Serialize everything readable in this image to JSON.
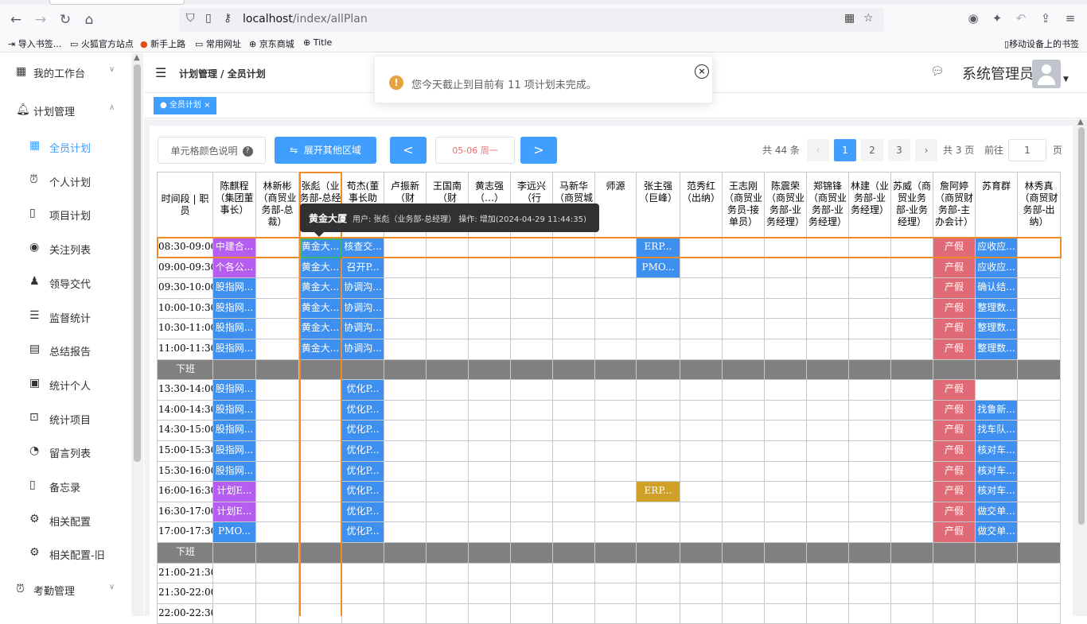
{
  "browser": {
    "url_host": "localhost",
    "url_path": "/index/allPlan",
    "bookmarks": [
      "导入书签...",
      "火狐官方站点",
      "新手上路",
      "常用网址",
      "京东商城",
      "Title"
    ],
    "mobile_bookmarks": "移动设备上的书签"
  },
  "sidebar": {
    "top_items": [
      {
        "label": "我的工作台",
        "icon": "calendar-icon"
      },
      {
        "label": "计划管理",
        "icon": "bell-icon"
      },
      {
        "label": "考勤管理",
        "icon": "alarm-icon"
      }
    ],
    "sub_items": [
      {
        "label": "全员计划",
        "icon": "calendar-icon",
        "active": true
      },
      {
        "label": "个人计划",
        "icon": "alarm-icon"
      },
      {
        "label": "项目计划",
        "icon": "phone-icon"
      },
      {
        "label": "关注列表",
        "icon": "eye-icon"
      },
      {
        "label": "领导交代",
        "icon": "user-icon"
      },
      {
        "label": "监督统计",
        "icon": "list-icon"
      },
      {
        "label": "总结报告",
        "icon": "document-icon"
      },
      {
        "label": "统计个人",
        "icon": "briefcase-icon"
      },
      {
        "label": "统计项目",
        "icon": "presentation-icon"
      },
      {
        "label": "留言列表",
        "icon": "chat-icon"
      },
      {
        "label": "备忘录",
        "icon": "phone-icon"
      },
      {
        "label": "相关配置",
        "icon": "gear-icon"
      },
      {
        "label": "相关配置-旧",
        "icon": "gear-icon"
      }
    ]
  },
  "header": {
    "breadcrumb": "计划管理 / 全员计划",
    "username": "系统管理员",
    "tag": "全员计划"
  },
  "notification": {
    "message": "您今天截止到目前有 11 项计划未完成。"
  },
  "toolbar": {
    "legend_label": "单元格颜色说明",
    "expand_label": "展开其他区域",
    "prev_label": "<",
    "next_label": ">",
    "date_value": "05-06 周一"
  },
  "pagination": {
    "total": "共 44 条",
    "pages": [
      "1",
      "2",
      "3"
    ],
    "current": "1",
    "page_count": "共 3 页",
    "goto_label": "前往",
    "goto_value": "1",
    "page_suffix": "页"
  },
  "tooltip": {
    "title": "黄金大厦",
    "info": "用户: 张彪（业务部-总经理） 操作: 增加(2024-04-29 11:44:35)"
  },
  "table": {
    "columns": [
      "时间段 | 职员",
      "陈麒程（集团董事长）",
      "林新彬（商贸业务部-总裁）",
      "张彪（业务部-总经理）",
      "苟杰(董事长助理)",
      "卢振新（财务…）",
      "王国南（财务…）",
      "黄志强（…）",
      "李远兴（行政…）",
      "马新华（商贸城市物业-部长）",
      "师源",
      "张主强（巨峰）",
      "范秀红（出纳）",
      "王志刚（商贸业务员-接单员）",
      "陈震荣（商贸业务部-业务经理）",
      "郑锦锋（商贸业务部-业务经理）",
      "林建（业务部-业务经理）",
      "苏威（商贸业务部-业务经理）",
      "詹阿婷（商贸财务部-主办会计）",
      "苏育群",
      "林秀真（商贸财务部-出纳）"
    ],
    "rows": [
      {
        "time": "08:30-09:00",
        "cells": [
          "中建合...",
          "",
          "黄金大...",
          "核查交...",
          "",
          "",
          "",
          "",
          "",
          "",
          "ERP...",
          "",
          "",
          "",
          "",
          "",
          "",
          "产假",
          "应收应...",
          ""
        ]
      },
      {
        "time": "09:00-09:30",
        "cells": [
          "个各公...",
          "",
          "黄金大...",
          "召开P...",
          "",
          "",
          "",
          "",
          "",
          "",
          "PMO...",
          "",
          "",
          "",
          "",
          "",
          "",
          "产假",
          "应收应...",
          ""
        ]
      },
      {
        "time": "09:30-10:00",
        "cells": [
          "股指网...",
          "",
          "黄金大...",
          "协调沟...",
          "",
          "",
          "",
          "",
          "",
          "",
          "",
          "",
          "",
          "",
          "",
          "",
          "",
          "产假",
          "确认结...",
          ""
        ]
      },
      {
        "time": "10:00-10:30",
        "cells": [
          "股指网...",
          "",
          "黄金大...",
          "协调沟...",
          "",
          "",
          "",
          "",
          "",
          "",
          "",
          "",
          "",
          "",
          "",
          "",
          "",
          "产假",
          "整理数...",
          ""
        ]
      },
      {
        "time": "10:30-11:00",
        "cells": [
          "股指网...",
          "",
          "黄金大...",
          "协调沟...",
          "",
          "",
          "",
          "",
          "",
          "",
          "",
          "",
          "",
          "",
          "",
          "",
          "",
          "产假",
          "整理数...",
          ""
        ]
      },
      {
        "time": "11:00-11:30",
        "cells": [
          "股指网...",
          "",
          "黄金大...",
          "协调沟...",
          "",
          "",
          "",
          "",
          "",
          "",
          "",
          "",
          "",
          "",
          "",
          "",
          "",
          "产假",
          "整理数...",
          ""
        ]
      },
      {
        "time": "下班",
        "break": true
      },
      {
        "time": "13:30-14:00",
        "cells": [
          "股指网...",
          "",
          "",
          "优化P...",
          "",
          "",
          "",
          "",
          "",
          "",
          "",
          "",
          "",
          "",
          "",
          "",
          "",
          "产假",
          "",
          ""
        ]
      },
      {
        "time": "14:00-14:30",
        "cells": [
          "股指网...",
          "",
          "",
          "优化P...",
          "",
          "",
          "",
          "",
          "",
          "",
          "",
          "",
          "",
          "",
          "",
          "",
          "",
          "产假",
          "找鲁新...",
          ""
        ]
      },
      {
        "time": "14:30-15:00",
        "cells": [
          "股指网...",
          "",
          "",
          "优化P...",
          "",
          "",
          "",
          "",
          "",
          "",
          "",
          "",
          "",
          "",
          "",
          "",
          "",
          "产假",
          "找车队...",
          ""
        ]
      },
      {
        "time": "15:00-15:30",
        "cells": [
          "股指网...",
          "",
          "",
          "优化P...",
          "",
          "",
          "",
          "",
          "",
          "",
          "",
          "",
          "",
          "",
          "",
          "",
          "",
          "产假",
          "核对车...",
          ""
        ]
      },
      {
        "time": "15:30-16:00",
        "cells": [
          "股指网...",
          "",
          "",
          "优化P...",
          "",
          "",
          "",
          "",
          "",
          "",
          "",
          "",
          "",
          "",
          "",
          "",
          "",
          "产假",
          "核对车...",
          ""
        ]
      },
      {
        "time": "16:00-16:30",
        "cells": [
          "计划E...",
          "",
          "",
          "优化P...",
          "",
          "",
          "",
          "",
          "",
          "",
          "ERP...",
          "",
          "",
          "",
          "",
          "",
          "",
          "产假",
          "核对车...",
          ""
        ]
      },
      {
        "time": "16:30-17:00",
        "cells": [
          "计划E...",
          "",
          "",
          "优化P...",
          "",
          "",
          "",
          "",
          "",
          "",
          "",
          "",
          "",
          "",
          "",
          "",
          "",
          "产假",
          "做交单...",
          ""
        ]
      },
      {
        "time": "17:00-17:30",
        "cells": [
          "PMO...",
          "",
          "",
          "优化P...",
          "",
          "",
          "",
          "",
          "",
          "",
          "",
          "",
          "",
          "",
          "",
          "",
          "",
          "产假",
          "做交单...",
          ""
        ]
      },
      {
        "time": "下班",
        "break": true
      },
      {
        "time": "21:00-21:30",
        "cells": [
          "",
          "",
          "",
          "",
          "",
          "",
          "",
          "",
          "",
          "",
          "",
          "",
          "",
          "",
          "",
          "",
          "",
          "",
          "",
          ""
        ]
      },
      {
        "time": "21:30-22:00",
        "cells": [
          "",
          "",
          "",
          "",
          "",
          "",
          "",
          "",
          "",
          "",
          "",
          "",
          "",
          "",
          "",
          "",
          "",
          "",
          "",
          ""
        ]
      },
      {
        "time": "22:00-22:30",
        "cells": [
          "",
          "",
          "",
          "",
          "",
          "",
          "",
          "",
          "",
          "",
          "",
          "",
          "",
          "",
          "",
          "",
          "",
          "",
          "",
          ""
        ]
      }
    ],
    "colors": {
      "purple": "#b55df0",
      "blue": "#3d8ff0",
      "red": "#e06a75",
      "gold": "#d1a028",
      "break": "#808080"
    },
    "cell_colors": [
      [
        "purple",
        "",
        "blue",
        "blue",
        "",
        "",
        "",
        "",
        "",
        "",
        "blue",
        "",
        "",
        "",
        "",
        "",
        "",
        "red",
        "blue",
        ""
      ],
      [
        "purple",
        "",
        "blue",
        "blue",
        "",
        "",
        "",
        "",
        "",
        "",
        "blue",
        "",
        "",
        "",
        "",
        "",
        "",
        "red",
        "blue",
        ""
      ],
      [
        "blue",
        "",
        "blue",
        "blue",
        "",
        "",
        "",
        "",
        "",
        "",
        "",
        "",
        "",
        "",
        "",
        "",
        "",
        "red",
        "blue",
        ""
      ],
      [
        "blue",
        "",
        "blue",
        "blue",
        "",
        "",
        "",
        "",
        "",
        "",
        "",
        "",
        "",
        "",
        "",
        "",
        "",
        "red",
        "blue",
        ""
      ],
      [
        "blue",
        "",
        "blue",
        "blue",
        "",
        "",
        "",
        "",
        "",
        "",
        "",
        "",
        "",
        "",
        "",
        "",
        "",
        "red",
        "blue",
        ""
      ],
      [
        "blue",
        "",
        "blue",
        "blue",
        "",
        "",
        "",
        "",
        "",
        "",
        "",
        "",
        "",
        "",
        "",
        "",
        "",
        "red",
        "blue",
        ""
      ],
      null,
      [
        "blue",
        "",
        "",
        "blue",
        "",
        "",
        "",
        "",
        "",
        "",
        "",
        "",
        "",
        "",
        "",
        "",
        "",
        "red",
        "",
        ""
      ],
      [
        "blue",
        "",
        "",
        "blue",
        "",
        "",
        "",
        "",
        "",
        "",
        "",
        "",
        "",
        "",
        "",
        "",
        "",
        "red",
        "blue",
        ""
      ],
      [
        "blue",
        "",
        "",
        "blue",
        "",
        "",
        "",
        "",
        "",
        "",
        "",
        "",
        "",
        "",
        "",
        "",
        "",
        "red",
        "blue",
        ""
      ],
      [
        "blue",
        "",
        "",
        "blue",
        "",
        "",
        "",
        "",
        "",
        "",
        "",
        "",
        "",
        "",
        "",
        "",
        "",
        "red",
        "blue",
        ""
      ],
      [
        "blue",
        "",
        "",
        "blue",
        "",
        "",
        "",
        "",
        "",
        "",
        "",
        "",
        "",
        "",
        "",
        "",
        "",
        "red",
        "blue",
        ""
      ],
      [
        "purple",
        "",
        "",
        "blue",
        "",
        "",
        "",
        "",
        "",
        "",
        "gold",
        "",
        "",
        "",
        "",
        "",
        "",
        "red",
        "blue",
        ""
      ],
      [
        "purple",
        "",
        "",
        "blue",
        "",
        "",
        "",
        "",
        "",
        "",
        "",
        "",
        "",
        "",
        "",
        "",
        "",
        "red",
        "blue",
        ""
      ],
      [
        "blue",
        "",
        "",
        "blue",
        "",
        "",
        "",
        "",
        "",
        "",
        "",
        "",
        "",
        "",
        "",
        "",
        "",
        "red",
        "blue",
        ""
      ],
      null,
      [
        "",
        "",
        "",
        "",
        "",
        "",
        "",
        "",
        "",
        "",
        "",
        "",
        "",
        "",
        "",
        "",
        "",
        "",
        "",
        ""
      ],
      [
        "",
        "",
        "",
        "",
        "",
        "",
        "",
        "",
        "",
        "",
        "",
        "",
        "",
        "",
        "",
        "",
        "",
        "",
        "",
        ""
      ],
      [
        "",
        "",
        "",
        "",
        "",
        "",
        "",
        "",
        "",
        "",
        "",
        "",
        "",
        "",
        "",
        "",
        "",
        "",
        "",
        ""
      ]
    ]
  }
}
